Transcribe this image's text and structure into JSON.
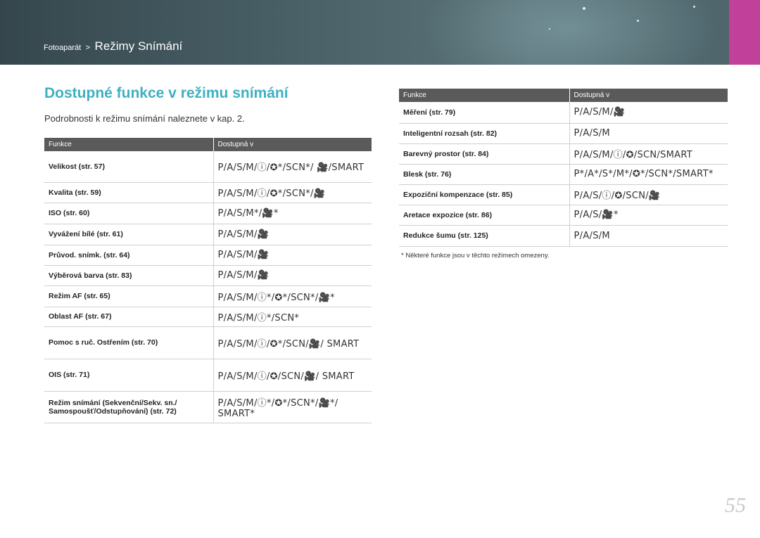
{
  "header": {
    "breadcrumb_parent": "Fotoaparát",
    "breadcrumb_separator": ">",
    "breadcrumb_current": "Režimy Snímání",
    "accent_color": "#c0409a"
  },
  "title": "Dostupné funkce v režimu snímání",
  "intro": "Podrobnosti k režimu snímání naleznete v kap. 2.",
  "left_table": {
    "headers": [
      "Funkce",
      "Dostupná v"
    ],
    "rows": [
      {
        "func": "Velikost (str. 57)",
        "modes": "P/A/S/M/ⓘ/✪*/SCN*/ 🎥/SMART"
      },
      {
        "func": "Kvalita (str. 59)",
        "modes": "P/A/S/M/ⓘ/✪*/SCN*/🎥"
      },
      {
        "func": "ISO (str. 60)",
        "modes": "P/A/S/M*/🎥*"
      },
      {
        "func": "Vyvážení bílé (str. 61)",
        "modes": "P/A/S/M/🎥"
      },
      {
        "func": "Průvod. snímk. (str. 64)",
        "modes": "P/A/S/M/🎥"
      },
      {
        "func": "Výběrová barva (str. 83)",
        "modes": "P/A/S/M/🎥"
      },
      {
        "func": "Režim AF (str. 65)",
        "modes": "P/A/S/M/ⓘ*/✪*/SCN*/🎥*"
      },
      {
        "func": "Oblast AF (str. 67)",
        "modes": "P/A/S/M/ⓘ*/SCN*"
      },
      {
        "func": "Pomoc s ruč. Ostřením (str. 70)",
        "modes": "P/A/S/M/ⓘ/✪*/SCN/🎥/ SMART"
      },
      {
        "func": "OIS (str. 71)",
        "modes": "P/A/S/M/ⓘ/✪/SCN/🎥/ SMART"
      },
      {
        "func": "Režim snímání (Sekvenční/Sekv. sn./ Samospoušť/Odstupňování) (str. 72)",
        "modes": "P/A/S/M/ⓘ*/✪*/SCN*/🎥*/ SMART*"
      }
    ]
  },
  "right_table": {
    "headers": [
      "Funkce",
      "Dostupná v"
    ],
    "rows": [
      {
        "func": "Měření (str. 79)",
        "modes": "P/A/S/M/🎥"
      },
      {
        "func": "Inteligentní rozsah (str. 82)",
        "modes": "P/A/S/M"
      },
      {
        "func": "Barevný prostor (str. 84)",
        "modes": "P/A/S/M/ⓘ/✪/SCN/SMART"
      },
      {
        "func": "Blesk (str. 76)",
        "modes": "P*/A*/S*/M*/✪*/SCN*/SMART*"
      },
      {
        "func": "Expoziční kompenzace (str. 85)",
        "modes": "P/A/S/ⓘ/✪/SCN/🎥"
      },
      {
        "func": "Aretace expozice (str. 86)",
        "modes": "P/A/S/🎥*"
      },
      {
        "func": "Redukce šumu (str. 125)",
        "modes": "P/A/S/M"
      }
    ]
  },
  "note": "* Některé funkce jsou v těchto režimech omezeny.",
  "page_number": "55"
}
